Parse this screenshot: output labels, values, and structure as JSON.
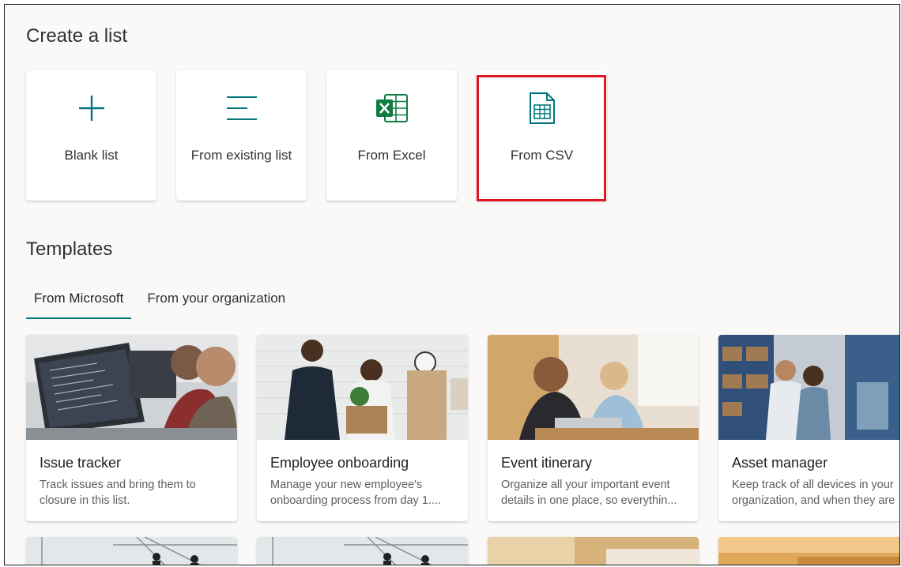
{
  "create_section": {
    "heading": "Create a list",
    "options": [
      {
        "label": "Blank list",
        "icon": "plus-icon"
      },
      {
        "label": "From existing list",
        "icon": "list-lines-icon"
      },
      {
        "label": "From Excel",
        "icon": "excel-icon"
      },
      {
        "label": "From CSV",
        "icon": "csv-file-icon"
      }
    ],
    "highlighted_option": "From CSV"
  },
  "templates_section": {
    "heading": "Templates",
    "tabs": [
      {
        "label": "From Microsoft",
        "active": true
      },
      {
        "label": "From your organization",
        "active": false
      }
    ],
    "cards": [
      {
        "title": "Issue tracker",
        "desc_line1": "Track issues and bring them to",
        "desc_line2": "closure in this list."
      },
      {
        "title": "Employee onboarding",
        "desc_line1": "Manage your new employee's",
        "desc_line2": "onboarding process from day 1...."
      },
      {
        "title": "Event itinerary",
        "desc_line1": "Organize all your important event",
        "desc_line2": "details in one place, so everythin..."
      },
      {
        "title": "Asset manager",
        "desc_line1": "Keep track of all devices in your",
        "desc_line2": "organization, and when they are"
      }
    ]
  },
  "colors": {
    "accent_teal": "#03787c",
    "excel_green": "#107c41",
    "highlight_red": "#e0151f",
    "page_bg": "#faf9f8"
  }
}
